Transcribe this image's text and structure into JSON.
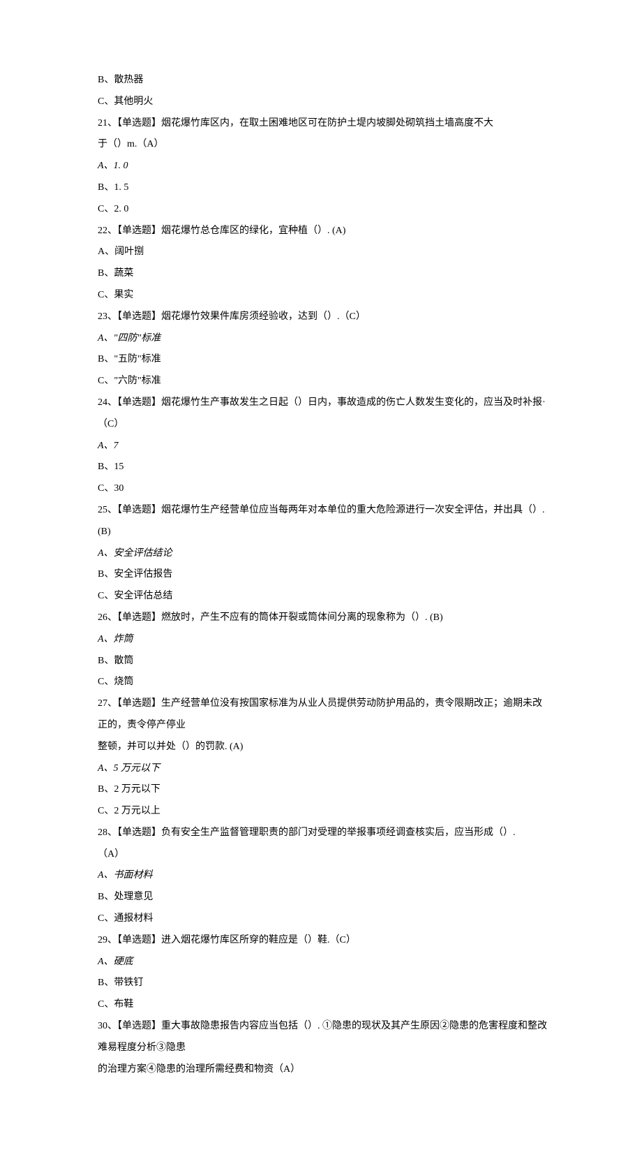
{
  "lines": [
    {
      "text": "B、散热器"
    },
    {
      "text": "C、其他明火"
    },
    {
      "text": "21、【单选题】烟花爆竹库区内，在取土困难地区可在防护土堤内坡脚处砌筑挡土墙高度不大"
    },
    {
      "text": "于（）m.（A）"
    },
    {
      "text": "A、1. 0",
      "italic": true
    },
    {
      "text": "B、1. 5"
    },
    {
      "text": "C、2. 0"
    },
    {
      "text": "22、【单选题】烟花爆竹总仓库区的绿化，宜种植（）. (A)"
    },
    {
      "text": "A、阔叶捌"
    },
    {
      "text": "B、蔬菜"
    },
    {
      "text": "C、果实"
    },
    {
      "text": "23、【单选题】烟花爆竹效果件库房须经验收，达到（）.（C）"
    },
    {
      "text": "A、\"四防\"标准",
      "italic": true
    },
    {
      "text": "B、\"五防\"标准"
    },
    {
      "text": "C、\"六防\"标准"
    },
    {
      "text": "24、【单选题】烟花爆竹生产事故发生之日起（）日内，事故造成的伤亡人数发生变化的，应当及时补报·（C）"
    },
    {
      "text": "A、7",
      "italic": true
    },
    {
      "text": "B、15"
    },
    {
      "text": "C、30"
    },
    {
      "text": "25、【单选题】烟花爆竹生产经营单位应当每两年对本单位的重大危险源进行一次安全评估，并出具（）. (B)"
    },
    {
      "text": "A、安全评估结论",
      "italic": true
    },
    {
      "text": "B、安全评估报告"
    },
    {
      "text": "C、安全评估总结"
    },
    {
      "text": "26、【单选题】燃放时，产生不应有的筒体开裂或筒体间分离的现象称为（）. (B)"
    },
    {
      "text": "A、炸筒",
      "italic": true
    },
    {
      "text": "B、散筒"
    },
    {
      "text": "C、烧筒"
    },
    {
      "text": "27、【单选题】生产经营单位没有按国家标准为从业人员提供劳动防护用品的，责令限期改正；逾期未改正的，责令停产停业"
    },
    {
      "text": "整顿，并可以并处（）的罚款. (A)"
    },
    {
      "text": "A、5 万元以下",
      "italic": true
    },
    {
      "text": "B、2 万元以下"
    },
    {
      "text": "C、2 万元以上"
    },
    {
      "text": "28、【单选题】负有安全生产监督管理职责的部门对受理的举报事项经调查核实后，应当形成（）."
    },
    {
      "text": "（A）"
    },
    {
      "text": "A、书面材料",
      "italic": true
    },
    {
      "text": "B、处理意见"
    },
    {
      "text": "C、通报材料"
    },
    {
      "text": "29、【单选题】进入烟花爆竹库区所穿的鞋应是（）鞋.（C）"
    },
    {
      "text": "A、硬底",
      "italic": true
    },
    {
      "text": "B、带铁钉"
    },
    {
      "text": "C、布鞋"
    },
    {
      "text": "30、【单选题】重大事故隐患报告内容应当包括（）. ①隐患的现状及其产生原因②隐患的危害程度和整改难易程度分析③隐患"
    },
    {
      "text": "的治理方案④隐患的治理所需经费和物资（A）"
    }
  ]
}
